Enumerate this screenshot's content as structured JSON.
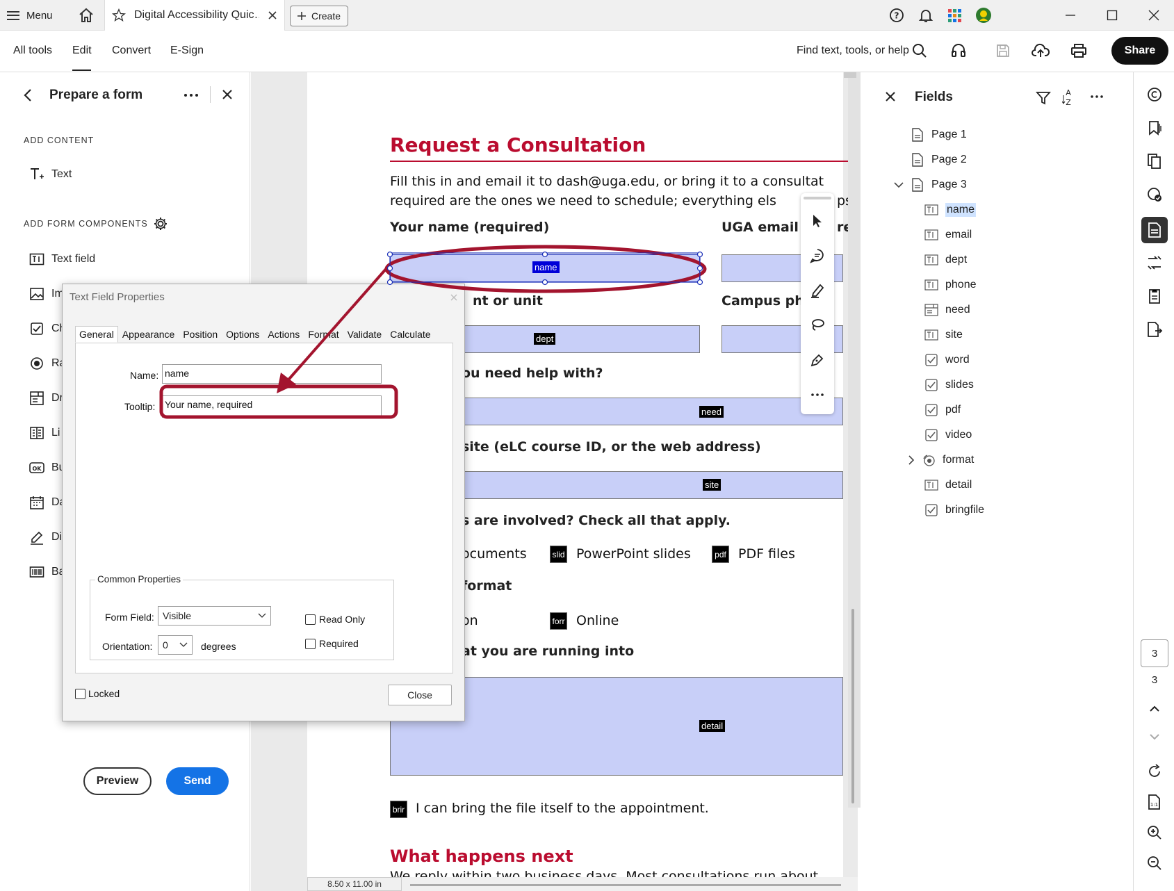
{
  "titlebar": {
    "menu_label": "Menu",
    "doc_tab_title": "Digital Accessibility Quic…",
    "create_label": "Create"
  },
  "toolbar": {
    "tabs": [
      "All tools",
      "Edit",
      "Convert",
      "E-Sign"
    ],
    "active_tab": "Edit",
    "find_label": "Find text, tools, or help",
    "share_label": "Share"
  },
  "left_panel": {
    "title": "Prepare a form",
    "add_content_label": "ADD CONTENT",
    "text_tool_label": "Text",
    "add_form_components_label": "ADD FORM COMPONENTS",
    "components": [
      {
        "label": "Text field",
        "icon": "text-field-icon"
      },
      {
        "label": "Im",
        "icon": "image-icon"
      },
      {
        "label": "Ch",
        "icon": "checkbox-icon"
      },
      {
        "label": "Ra",
        "icon": "radio-icon"
      },
      {
        "label": "Dr",
        "icon": "dropdown-icon"
      },
      {
        "label": "Li",
        "icon": "list-icon"
      },
      {
        "label": "Bu",
        "icon": "button-icon"
      },
      {
        "label": "Da",
        "icon": "date-icon"
      },
      {
        "label": "Di",
        "icon": "signature-icon"
      },
      {
        "label": "Ba",
        "icon": "barcode-icon"
      }
    ],
    "preview_label": "Preview",
    "send_label": "Send"
  },
  "document": {
    "heading": "Request a Consultation",
    "intro_line1": "Fill this in and email it to dash@uga.edu, or bring it to a consultat",
    "intro_line2": "required are the ones we need to schedule; everything els",
    "intro_line2_tail": "ps",
    "name_label": "Your name (required)",
    "email_label": "UGA email",
    "email_label_tail": "re",
    "dept_label": "nt or unit",
    "phone_label": "Campus ph",
    "need_label": "ou need help with?",
    "site_label": "site (eLC course ID, or the web address)",
    "files_label": "s are involved? Check all that apply.",
    "documents_label": "ocuments",
    "slides_label": "PowerPoint slides",
    "pdf_label": "PDF files",
    "format_label": "format",
    "in_person_label": "on",
    "online_label": "Online",
    "detail_label": "at you are running into",
    "bring_label": "I can bring the file itself to the appointment.",
    "next_heading": "What happens next",
    "next_text": "We reply within two business days. Most consultations run about",
    "field_tags": {
      "name": "name",
      "dept": "dept",
      "need": "need",
      "site": "site",
      "detail": "detail",
      "slides": "slid",
      "pdf": "pdf",
      "format": "forr",
      "bring": "brir"
    },
    "page_size": "8.50 x 11.00 in"
  },
  "dialog": {
    "title": "Text Field Properties",
    "tabs": [
      "General",
      "Appearance",
      "Position",
      "Options",
      "Actions",
      "Format",
      "Validate",
      "Calculate"
    ],
    "active_tab": "General",
    "name_label": "Name:",
    "name_value": "name",
    "tooltip_label": "Tooltip:",
    "tooltip_value": "Your name, required",
    "common_properties_label": "Common Properties",
    "form_field_label": "Form Field:",
    "form_field_value": "Visible",
    "orientation_label": "Orientation:",
    "orientation_value": "0",
    "degrees_label": "degrees",
    "read_only_label": "Read Only",
    "required_label": "Required",
    "locked_label": "Locked",
    "close_label": "Close"
  },
  "fields_panel": {
    "title": "Fields",
    "tree": [
      {
        "label": "Page 1",
        "icon": "page-icon"
      },
      {
        "label": "Page 2",
        "icon": "page-icon"
      },
      {
        "label": "Page 3",
        "icon": "page-icon"
      },
      {
        "label": "name",
        "icon": "text-field-icon",
        "selected": true
      },
      {
        "label": "email",
        "icon": "text-field-icon"
      },
      {
        "label": "dept",
        "icon": "text-field-icon"
      },
      {
        "label": "phone",
        "icon": "text-field-icon"
      },
      {
        "label": "need",
        "icon": "dropdown-field-icon"
      },
      {
        "label": "site",
        "icon": "text-field-icon"
      },
      {
        "label": "word",
        "icon": "checkbox-icon"
      },
      {
        "label": "slides",
        "icon": "checkbox-icon"
      },
      {
        "label": "pdf",
        "icon": "checkbox-icon"
      },
      {
        "label": "video",
        "icon": "checkbox-icon"
      },
      {
        "label": "format",
        "icon": "radio-group-icon"
      },
      {
        "label": "detail",
        "icon": "text-field-icon"
      },
      {
        "label": "bringfile",
        "icon": "checkbox-icon"
      }
    ]
  },
  "right_rail": {
    "current_page": "3",
    "total_pages": "3"
  },
  "colors": {
    "accent_red": "#ba0c2f",
    "field_fill": "#c8cff8",
    "send_blue": "#1473e6",
    "annotation_red": "#a3142e"
  }
}
